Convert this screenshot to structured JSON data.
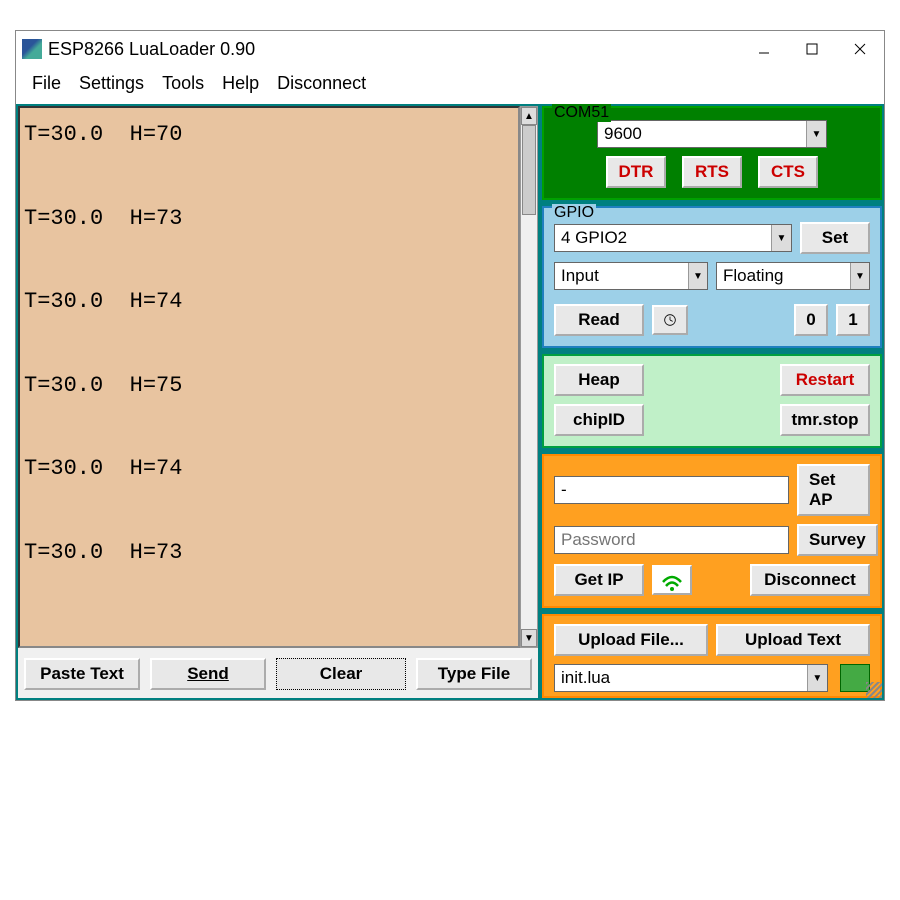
{
  "window": {
    "title": "ESP8266 LuaLoader 0.90"
  },
  "menu": {
    "file": "File",
    "settings": "Settings",
    "tools": "Tools",
    "help": "Help",
    "disconnect": "Disconnect"
  },
  "terminal": {
    "lines": [
      "T=30.0  H=70",
      "T=30.0  H=73",
      "T=30.0  H=74",
      "T=30.0  H=75",
      "T=30.0  H=74",
      "T=30.0  H=73"
    ]
  },
  "bottom": {
    "paste": "Paste Text",
    "send": "Send",
    "clear": "Clear",
    "typefile": "Type File"
  },
  "com": {
    "title": "COM51",
    "baud": "9600",
    "dtr": "DTR",
    "rts": "RTS",
    "cts": "CTS"
  },
  "gpio": {
    "title": "GPIO",
    "pin": "4 GPIO2",
    "set": "Set",
    "mode": "Input",
    "pull": "Floating",
    "read": "Read",
    "zero": "0",
    "one": "1"
  },
  "heap": {
    "heap": "Heap",
    "chipid": "chipID",
    "restart": "Restart",
    "tmrstop": "tmr.stop"
  },
  "wifi": {
    "ssid": "-",
    "password_placeholder": "Password",
    "setap": "Set AP",
    "survey": "Survey",
    "getip": "Get IP",
    "disconnect": "Disconnect"
  },
  "upload": {
    "uploadfile": "Upload File...",
    "uploadtext": "Upload Text",
    "filename": "init.lua"
  }
}
